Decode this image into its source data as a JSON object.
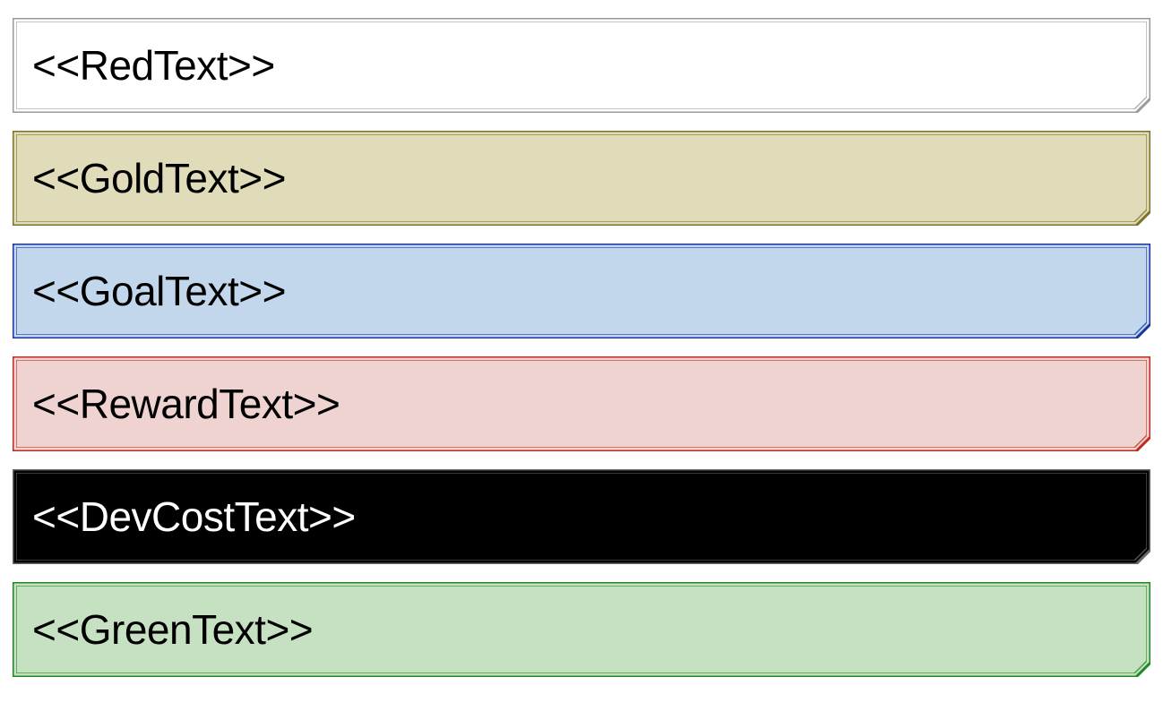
{
  "rows": {
    "red": {
      "label": "<<RedText>>"
    },
    "gold": {
      "label": "<<GoldText>>"
    },
    "goal": {
      "label": "<<GoalText>>"
    },
    "reward": {
      "label": "<<RewardText>>"
    },
    "dev": {
      "label": "<<DevCostText>>"
    },
    "green": {
      "label": "<<GreenText>>"
    }
  },
  "colors": {
    "red_border": "#9a9a9a",
    "gold_border": "#7d7226",
    "goal_border": "#1934a3",
    "reward_border": "#c02b1f",
    "dev_border": "#666666",
    "green_border": "#1e8a24"
  }
}
